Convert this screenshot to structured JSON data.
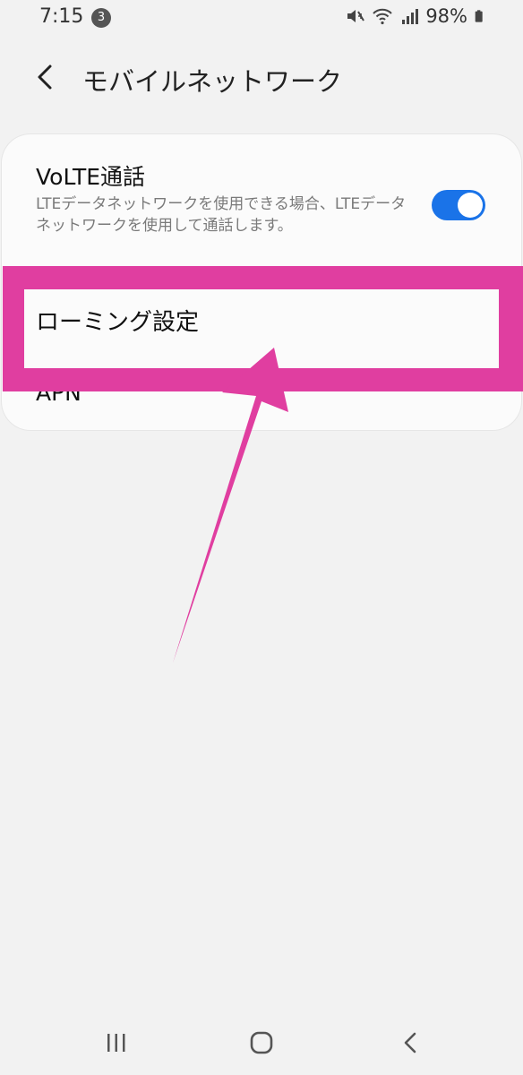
{
  "status_bar": {
    "time": "7:15",
    "notification_count": "3",
    "battery": "98%",
    "icons": [
      "mute-icon",
      "wifi-icon",
      "signal-icon",
      "battery-icon"
    ]
  },
  "header": {
    "back_icon": "chevron-left-icon",
    "title": "モバイルネットワーク"
  },
  "settings": {
    "volte": {
      "title": "VoLTE通話",
      "description": "LTEデータネットワークを使用できる場合、LTEデータネットワークを使用して通話します。",
      "enabled": true
    },
    "roaming_label": "ローミング設定",
    "apn_label": "APN"
  },
  "annotation": {
    "highlight_color": "#e03ea0"
  },
  "colors": {
    "toggle_on": "#1a73e8",
    "background": "#f2f2f2"
  },
  "nav_bar": {
    "icons": [
      "recent-apps-icon",
      "home-icon",
      "back-icon"
    ]
  }
}
